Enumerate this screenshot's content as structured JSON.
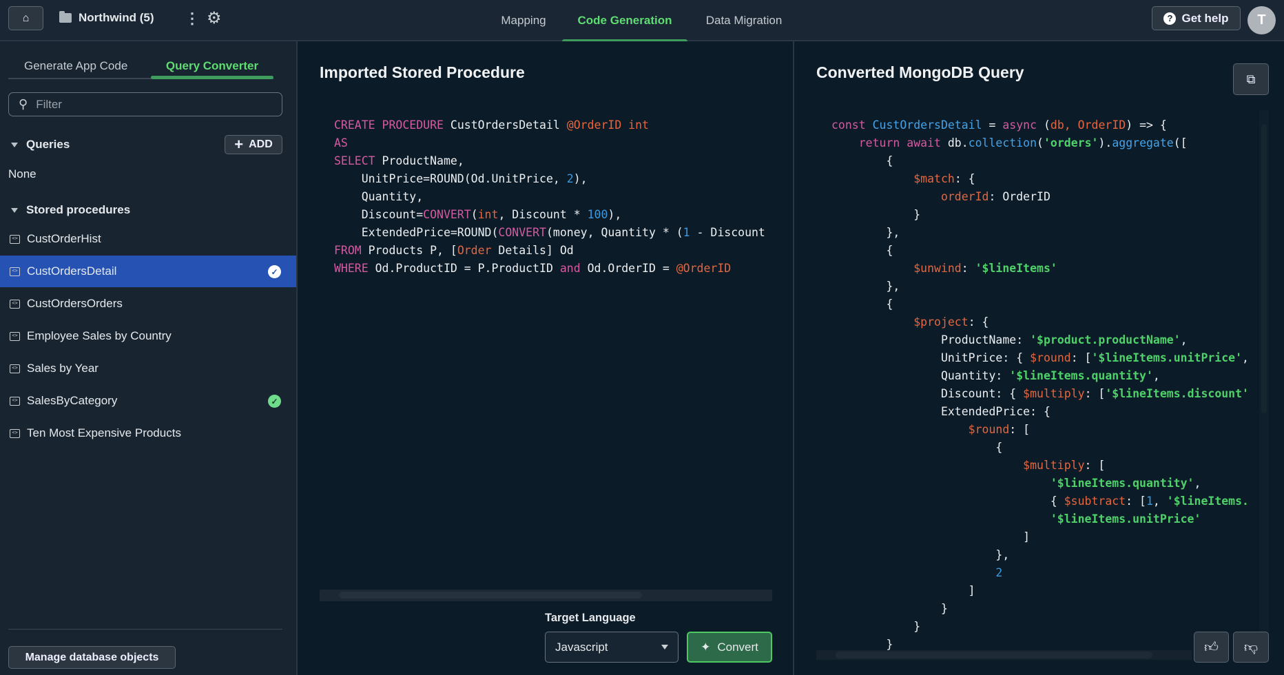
{
  "topbar": {
    "project": "Northwind (5)",
    "nav": [
      "Mapping",
      "Code Generation",
      "Data Migration"
    ],
    "active_nav": "Code Generation",
    "help_label": "Get help",
    "avatar_initial": "T"
  },
  "sidebar": {
    "tabs": [
      "Generate App Code",
      "Query Converter"
    ],
    "active_tab": "Query Converter",
    "filter_placeholder": "Filter",
    "queries_label": "Queries",
    "add_label": "ADD",
    "queries_empty": "None",
    "stored_label": "Stored procedures",
    "items": [
      {
        "label": "CustOrderHist",
        "selected": false,
        "converted": false
      },
      {
        "label": "CustOrdersDetail",
        "selected": true,
        "converted": true
      },
      {
        "label": "CustOrdersOrders",
        "selected": false,
        "converted": false
      },
      {
        "label": "Employee Sales by Country",
        "selected": false,
        "converted": false
      },
      {
        "label": "Sales by Year",
        "selected": false,
        "converted": false
      },
      {
        "label": "SalesByCategory",
        "selected": false,
        "converted": true
      },
      {
        "label": "Ten Most Expensive Products",
        "selected": false,
        "converted": false
      }
    ],
    "manage_label": "Manage database objects"
  },
  "colors": {
    "accent": "#5fdc72",
    "selected": "#2653b3",
    "check_green": "#6fdc8c"
  },
  "source": {
    "title": "Imported Stored Procedure",
    "lines": [
      {
        "i": 0,
        "tokens": [
          [
            "k",
            "CREATE PROCEDURE "
          ],
          [
            "p",
            "CustOrdersDetail "
          ],
          [
            "v",
            "@OrderID int"
          ]
        ]
      },
      {
        "i": 0,
        "tokens": [
          [
            "k",
            "AS"
          ]
        ]
      },
      {
        "i": 0,
        "tokens": [
          [
            "k",
            "SELECT "
          ],
          [
            "p",
            "ProductName,"
          ]
        ]
      },
      {
        "i": 1,
        "tokens": [
          [
            "p",
            "UnitPrice=ROUND(Od.UnitPrice, "
          ],
          [
            "n",
            "2"
          ],
          [
            "p",
            "),"
          ]
        ]
      },
      {
        "i": 1,
        "tokens": [
          [
            "p",
            "Quantity,"
          ]
        ]
      },
      {
        "i": 1,
        "tokens": [
          [
            "p",
            "Discount="
          ],
          [
            "k",
            "CONVERT"
          ],
          [
            "p",
            "("
          ],
          [
            "v",
            "int"
          ],
          [
            "p",
            ", Discount * "
          ],
          [
            "n",
            "100"
          ],
          [
            "p",
            "),"
          ]
        ]
      },
      {
        "i": 1,
        "tokens": [
          [
            "p",
            "ExtendedPrice=ROUND("
          ],
          [
            "k",
            "CONVERT"
          ],
          [
            "p",
            "(money, Quantity * ("
          ],
          [
            "n",
            "1"
          ],
          [
            "p",
            " - Discount"
          ]
        ]
      },
      {
        "i": 0,
        "tokens": [
          [
            "k",
            "FROM "
          ],
          [
            "p",
            "Products P, ["
          ],
          [
            "v",
            "Order"
          ],
          [
            "p",
            " Details] Od"
          ]
        ]
      },
      {
        "i": 0,
        "tokens": [
          [
            "k",
            "WHERE "
          ],
          [
            "p",
            "Od.ProductID = P.ProductID "
          ],
          [
            "k",
            "and "
          ],
          [
            "p",
            "Od.OrderID = "
          ],
          [
            "v",
            "@OrderID"
          ]
        ]
      }
    ]
  },
  "controls": {
    "target_label": "Target Language",
    "language": "Javascript",
    "convert_label": "Convert"
  },
  "result": {
    "title": "Converted MongoDB Query",
    "lines": [
      {
        "i": 0,
        "tokens": [
          [
            "k",
            "const "
          ],
          [
            "f",
            "CustOrdersDetail"
          ],
          [
            "p",
            " = "
          ],
          [
            "k",
            "async "
          ],
          [
            "p",
            "("
          ],
          [
            "v",
            "db, OrderID"
          ],
          [
            "p",
            ") => {"
          ]
        ]
      },
      {
        "i": 1,
        "tokens": [
          [
            "k",
            "return await "
          ],
          [
            "p",
            "db."
          ],
          [
            "f",
            "collection"
          ],
          [
            "p",
            "("
          ],
          [
            "s",
            "'orders'"
          ],
          [
            "p",
            ")."
          ],
          [
            "f",
            "aggregate"
          ],
          [
            "p",
            "(["
          ]
        ]
      },
      {
        "i": 2,
        "tokens": [
          [
            "p",
            "{"
          ]
        ]
      },
      {
        "i": 3,
        "tokens": [
          [
            "v",
            "$match"
          ],
          [
            "p",
            ": {"
          ]
        ]
      },
      {
        "i": 4,
        "tokens": [
          [
            "v",
            "orderId"
          ],
          [
            "p",
            ": OrderID"
          ]
        ]
      },
      {
        "i": 3,
        "tokens": [
          [
            "p",
            "}"
          ]
        ]
      },
      {
        "i": 2,
        "tokens": [
          [
            "p",
            "},"
          ]
        ]
      },
      {
        "i": 2,
        "tokens": [
          [
            "p",
            "{"
          ]
        ]
      },
      {
        "i": 3,
        "tokens": [
          [
            "v",
            "$unwind"
          ],
          [
            "p",
            ": "
          ],
          [
            "s",
            "'$lineItems'"
          ]
        ]
      },
      {
        "i": 2,
        "tokens": [
          [
            "p",
            "},"
          ]
        ]
      },
      {
        "i": 2,
        "tokens": [
          [
            "p",
            "{"
          ]
        ]
      },
      {
        "i": 3,
        "tokens": [
          [
            "v",
            "$project"
          ],
          [
            "p",
            ": {"
          ]
        ]
      },
      {
        "i": 4,
        "tokens": [
          [
            "p",
            "ProductName: "
          ],
          [
            "s",
            "'$product.productName'"
          ],
          [
            "p",
            ","
          ]
        ]
      },
      {
        "i": 4,
        "tokens": [
          [
            "p",
            "UnitPrice: { "
          ],
          [
            "v",
            "$round"
          ],
          [
            "p",
            ": ["
          ],
          [
            "s",
            "'$lineItems.unitPrice'"
          ],
          [
            "p",
            ","
          ]
        ]
      },
      {
        "i": 4,
        "tokens": [
          [
            "p",
            "Quantity: "
          ],
          [
            "s",
            "'$lineItems.quantity'"
          ],
          [
            "p",
            ","
          ]
        ]
      },
      {
        "i": 4,
        "tokens": [
          [
            "p",
            "Discount: { "
          ],
          [
            "v",
            "$multiply"
          ],
          [
            "p",
            ": ["
          ],
          [
            "s",
            "'$lineItems.discount'"
          ]
        ]
      },
      {
        "i": 4,
        "tokens": [
          [
            "p",
            "ExtendedPrice: {"
          ]
        ]
      },
      {
        "i": 5,
        "tokens": [
          [
            "v",
            "$round"
          ],
          [
            "p",
            ": ["
          ]
        ]
      },
      {
        "i": 6,
        "tokens": [
          [
            "p",
            "{"
          ]
        ]
      },
      {
        "i": 7,
        "tokens": [
          [
            "v",
            "$multiply"
          ],
          [
            "p",
            ": ["
          ]
        ]
      },
      {
        "i": 8,
        "tokens": [
          [
            "s",
            "'$lineItems.quantity'"
          ],
          [
            "p",
            ","
          ]
        ]
      },
      {
        "i": 8,
        "tokens": [
          [
            "p",
            "{ "
          ],
          [
            "v",
            "$subtract"
          ],
          [
            "p",
            ": ["
          ],
          [
            "n",
            "1"
          ],
          [
            "p",
            ", "
          ],
          [
            "s",
            "'$lineItems."
          ]
        ]
      },
      {
        "i": 8,
        "tokens": [
          [
            "s",
            "'$lineItems.unitPrice'"
          ]
        ]
      },
      {
        "i": 7,
        "tokens": [
          [
            "p",
            "]"
          ]
        ]
      },
      {
        "i": 6,
        "tokens": [
          [
            "p",
            "},"
          ]
        ]
      },
      {
        "i": 6,
        "tokens": [
          [
            "n",
            "2"
          ]
        ]
      },
      {
        "i": 5,
        "tokens": [
          [
            "p",
            "]"
          ]
        ]
      },
      {
        "i": 4,
        "tokens": [
          [
            "p",
            "}"
          ]
        ]
      },
      {
        "i": 3,
        "tokens": [
          [
            "p",
            "}"
          ]
        ]
      },
      {
        "i": 2,
        "tokens": [
          [
            "p",
            "}"
          ]
        ]
      }
    ]
  }
}
